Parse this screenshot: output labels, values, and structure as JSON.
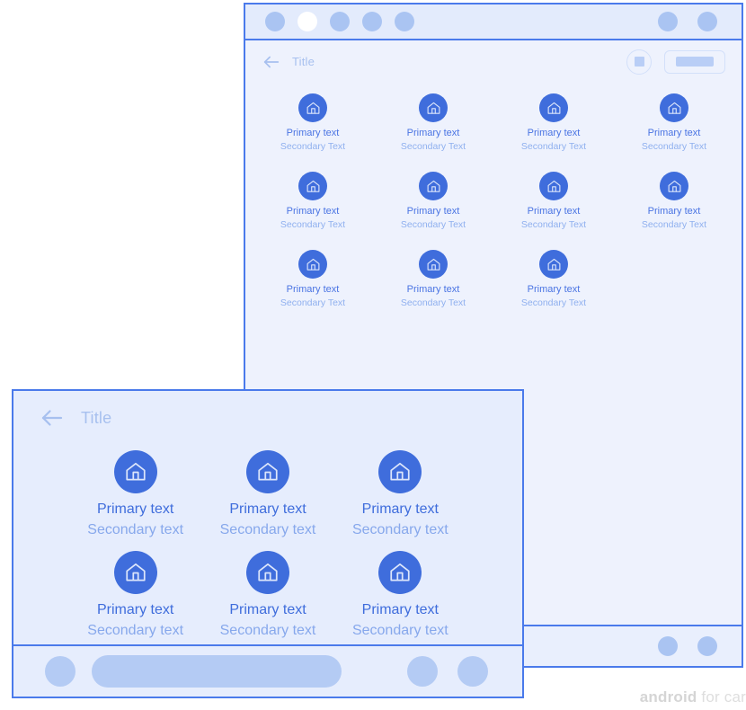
{
  "background_window": {
    "statusbar": {
      "left_dots": [
        {
          "name": "status-dot-1",
          "active": false
        },
        {
          "name": "status-dot-2",
          "active": true
        },
        {
          "name": "status-dot-3",
          "active": false
        },
        {
          "name": "status-dot-4",
          "active": false
        },
        {
          "name": "status-dot-5",
          "active": false
        }
      ],
      "right_dots": [
        {
          "name": "status-dot-right-1"
        },
        {
          "name": "status-dot-right-2"
        }
      ]
    },
    "appbar": {
      "back_icon": "arrow-left-icon",
      "title": "Title",
      "stop_button_icon": "square-stop-icon",
      "chip_button_label": ""
    },
    "grid": {
      "columns": 4,
      "tiles": [
        {
          "icon": "home-icon",
          "primary": "Primary text",
          "secondary": "Secondary Text"
        },
        {
          "icon": "home-icon",
          "primary": "Primary text",
          "secondary": "Secondary Text"
        },
        {
          "icon": "home-icon",
          "primary": "Primary text",
          "secondary": "Secondary Text"
        },
        {
          "icon": "home-icon",
          "primary": "Primary text",
          "secondary": "Secondary Text"
        },
        {
          "icon": "home-icon",
          "primary": "Primary text",
          "secondary": "Secondary Text"
        },
        {
          "icon": "home-icon",
          "primary": "Primary text",
          "secondary": "Secondary Text"
        },
        {
          "icon": "home-icon",
          "primary": "Primary text",
          "secondary": "Secondary Text"
        },
        {
          "icon": "home-icon",
          "primary": "Primary text",
          "secondary": "Secondary Text"
        },
        {
          "icon": "home-icon",
          "primary": "Primary text",
          "secondary": "Secondary Text"
        },
        {
          "icon": "home-icon",
          "primary": "Primary text",
          "secondary": "Secondary Text"
        },
        {
          "icon": "home-icon",
          "primary": "Primary text",
          "secondary": "Secondary Text"
        }
      ]
    },
    "bottombar": {
      "dots": [
        {
          "name": "bottom-dot-1"
        },
        {
          "name": "bottom-dot-2"
        }
      ]
    }
  },
  "foreground_window": {
    "appbar": {
      "back_icon": "arrow-left-icon",
      "title": "Title"
    },
    "grid": {
      "columns": 3,
      "tiles": [
        {
          "icon": "home-icon",
          "primary": "Primary text",
          "secondary": "Secondary text"
        },
        {
          "icon": "home-icon",
          "primary": "Primary text",
          "secondary": "Secondary text"
        },
        {
          "icon": "home-icon",
          "primary": "Primary text",
          "secondary": "Secondary text"
        },
        {
          "icon": "home-icon",
          "primary": "Primary text",
          "secondary": "Secondary text"
        },
        {
          "icon": "home-icon",
          "primary": "Primary text",
          "secondary": "Secondary text"
        },
        {
          "icon": "home-icon",
          "primary": "Primary text",
          "secondary": "Secondary text"
        }
      ]
    },
    "navbar": {
      "home_dot": "nav-circle-button",
      "search_pill": "nav-pill-button",
      "right_dot_1": "nav-circle-button-2",
      "right_dot_2": "nav-circle-button-3"
    }
  },
  "watermark": {
    "bold": "android",
    "light": " for car"
  },
  "colors": {
    "window_border": "#4a7aeb",
    "window_bg": "#eef2fd",
    "window_bg_front": "#e6edfd",
    "statusbar_bg": "#e3ebfc",
    "icon_circle": "#3f6ddc",
    "primary_text": "#3f6ddc",
    "secondary_text": "#87a8ec",
    "title_text": "#a7c0ef",
    "dot_fill": "#aac4f2",
    "dot_active": "#ffffff",
    "nav_shape": "#b4cbf4",
    "watermark": "#dadada"
  }
}
